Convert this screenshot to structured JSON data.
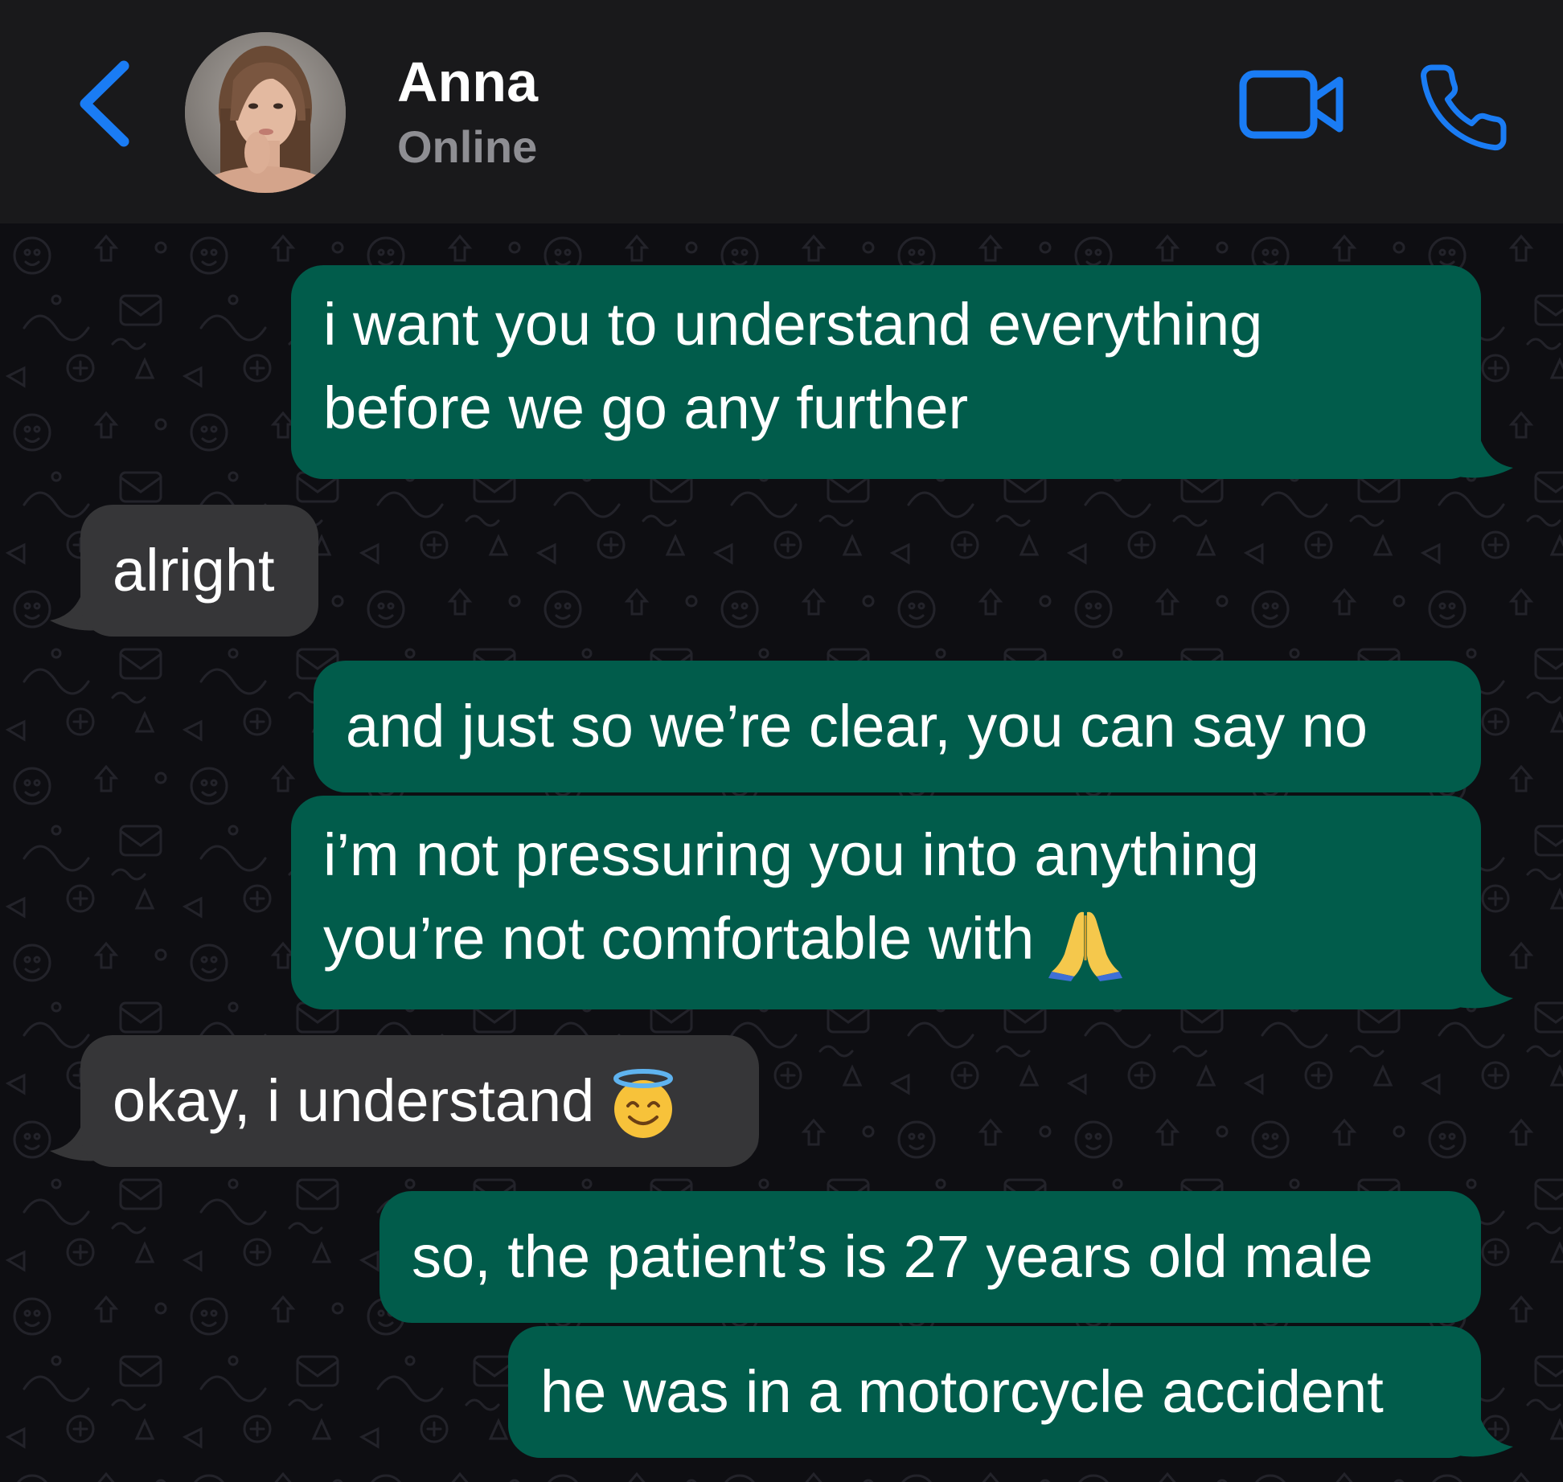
{
  "header": {
    "contact_name": "Anna",
    "contact_status": "Online",
    "accent_color": "#1a7cf4"
  },
  "icons": {
    "back": "chevron-left-icon",
    "video": "video-camera-icon",
    "call": "phone-icon",
    "pray": "folded-hands-emoji",
    "halo": "smiling-face-with-halo-emoji"
  },
  "colors": {
    "outgoing_bubble": "#015c4b",
    "incoming_bubble": "#363638",
    "header_bg": "#19191b"
  },
  "messages": [
    {
      "direction": "outgoing",
      "lines": [
        "i want you to understand everything",
        "before we go any further"
      ]
    },
    {
      "direction": "incoming",
      "lines": [
        "alright"
      ]
    },
    {
      "direction": "outgoing",
      "lines": [
        "and just so we’re clear, you can say no"
      ]
    },
    {
      "direction": "outgoing",
      "lines": [
        "i’m not pressuring you into anything",
        "you’re not comfortable with"
      ]
    },
    {
      "direction": "incoming",
      "lines": [
        "okay, i understand"
      ]
    },
    {
      "direction": "outgoing",
      "lines": [
        "so, the patient’s is 27 years old male"
      ]
    },
    {
      "direction": "outgoing",
      "lines": [
        "he was in a motorcycle accident"
      ]
    }
  ]
}
